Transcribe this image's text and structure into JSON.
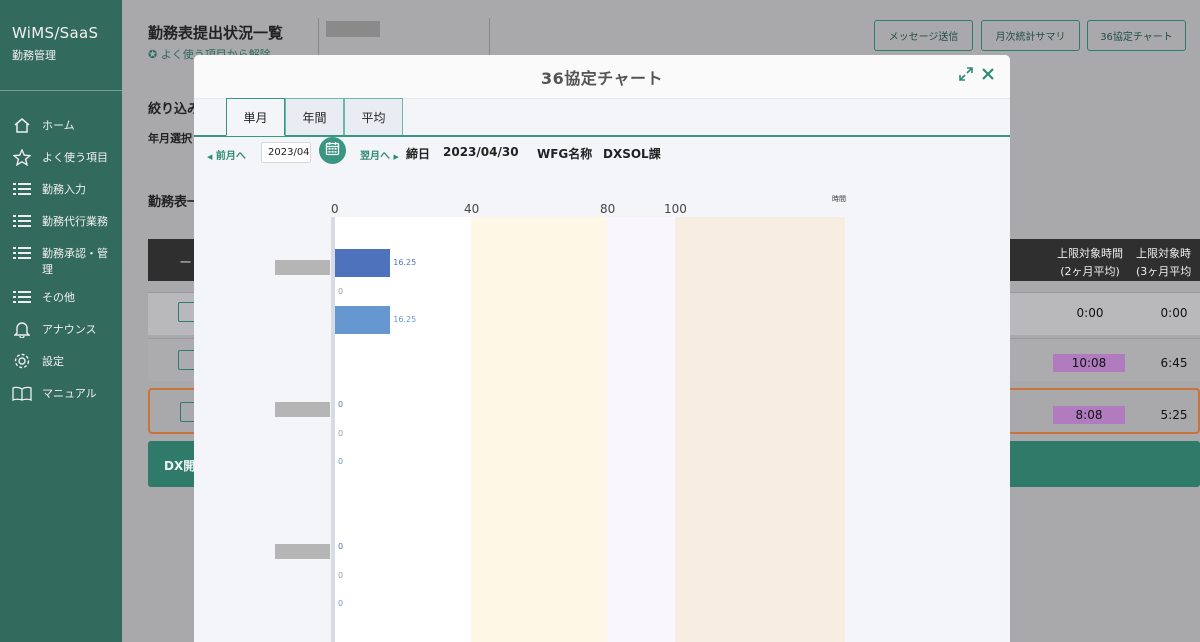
{
  "sidebar": {
    "brand": "WiMS/SaaS",
    "brand_sub": "勤務管理",
    "items": [
      {
        "label": "ホーム",
        "icon": "home-icon"
      },
      {
        "label": "よく使う項目",
        "icon": "star-icon"
      },
      {
        "label": "勤務入力",
        "icon": "list-icon"
      },
      {
        "label": "勤務代行業務",
        "icon": "list-icon"
      },
      {
        "label": "勤務承認・管理",
        "icon": "list-icon"
      },
      {
        "label": "その他",
        "icon": "list-icon"
      },
      {
        "label": "アナウンス",
        "icon": "bell-icon"
      },
      {
        "label": "設定",
        "icon": "gear-icon"
      },
      {
        "label": "マニュアル",
        "icon": "book-icon"
      }
    ]
  },
  "page": {
    "title": "勤務表提出状況一覧",
    "favorite_link": "よく使う項目から解除",
    "filter_title": "絞り込み",
    "year_label": "年月選択",
    "list_title": "勤務表一",
    "buttons": {
      "message": "メッセージ送信",
      "monthly": "月次統計サマリ",
      "chart36": "36協定チャート"
    },
    "table_headers": {
      "col1": "一",
      "col2": "上限対象時間\n(2ヶ月平均)",
      "col3": "上限対象時\n(3ヶ月平均"
    },
    "rows": [
      {
        "avg2": "0:00",
        "avg3": "0:00",
        "badge": false
      },
      {
        "avg2": "10:08",
        "avg3": "6:45",
        "badge": true
      },
      {
        "avg2": "8:08",
        "avg3": "5:25",
        "badge": true
      }
    ],
    "green_row_label": "DX開"
  },
  "modal": {
    "title": "36協定チャート",
    "tabs": [
      "単月",
      "年間",
      "平均"
    ],
    "active_tab": "単月",
    "prev_label": "前月へ",
    "next_label": "翌月へ",
    "month_value": "2023/04",
    "closing_label": "締日",
    "closing_date": "2023/04/30",
    "wfg_label": "WFG名称",
    "wfg_value": "DXSOL課"
  },
  "chart_data": {
    "type": "bar",
    "orientation": "horizontal",
    "unit": "時間",
    "xticks": [
      0,
      40,
      80,
      100
    ],
    "xlim": [
      0,
      150
    ],
    "bands": [
      {
        "from": 40,
        "to": 80,
        "color": "#fff7e6"
      },
      {
        "from": 80,
        "to": 100,
        "color": "#f9f7fd"
      },
      {
        "from": 100,
        "to": 150,
        "color": "#f8ede1"
      }
    ],
    "groups": [
      {
        "bars": [
          {
            "value": 16.25,
            "label": "16.25",
            "color": "#4f72bd"
          },
          {
            "value": 0,
            "label": "0",
            "color": "#9a9a9a"
          },
          {
            "value": 16.25,
            "label": "16.25",
            "color": "#6797d1"
          }
        ]
      },
      {
        "bars": [
          {
            "value": 0,
            "label": "0",
            "color": "#4f72bd"
          },
          {
            "value": 0,
            "label": "0",
            "color": "#9a9a9a"
          },
          {
            "value": 0,
            "label": "0",
            "color": "#6797d1"
          }
        ]
      },
      {
        "bars": [
          {
            "value": 0,
            "label": "0",
            "color": "#4f72bd"
          },
          {
            "value": 0,
            "label": "0",
            "color": "#9a9a9a"
          },
          {
            "value": 0,
            "label": "0",
            "color": "#6797d1"
          }
        ]
      }
    ]
  }
}
